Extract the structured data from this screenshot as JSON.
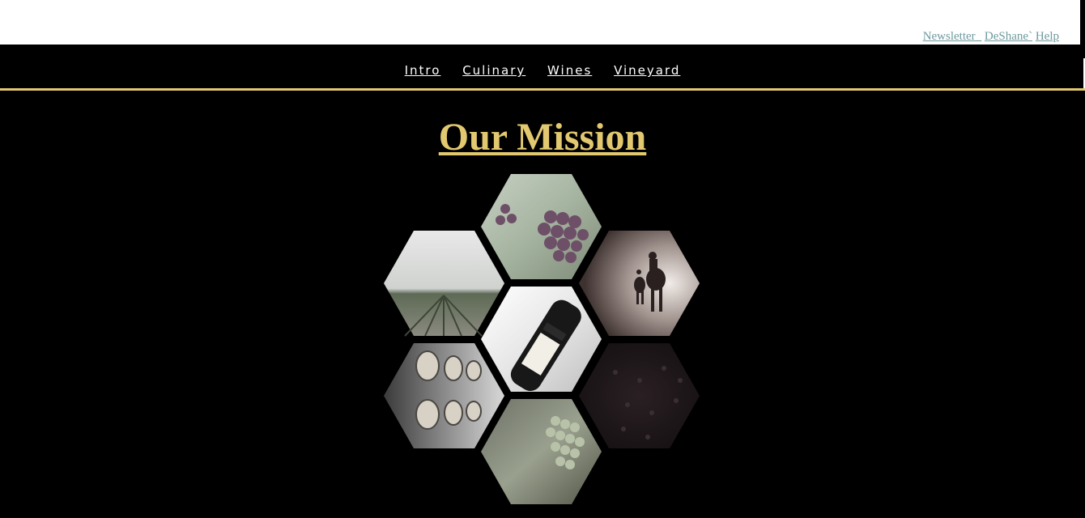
{
  "top_links": {
    "newsletter": "Newsletter_",
    "deshane": "DeShane`",
    "help": "Help"
  },
  "nav": {
    "items": [
      "Intro",
      "Culinary",
      "Wines",
      "Vineyard"
    ]
  },
  "main": {
    "title": "Our Mission"
  },
  "colors": {
    "gold": "#e2c86f",
    "link": "#6f9a9e",
    "background": "#000000"
  },
  "gallery": {
    "tiles": [
      {
        "name": "grapes-vine-photo"
      },
      {
        "name": "vineyard-field-photo"
      },
      {
        "name": "horse-riders-photo"
      },
      {
        "name": "champagne-bottle-photo"
      },
      {
        "name": "wine-barrels-photo"
      },
      {
        "name": "dark-foliage-photo"
      },
      {
        "name": "green-grapes-photo"
      }
    ]
  }
}
